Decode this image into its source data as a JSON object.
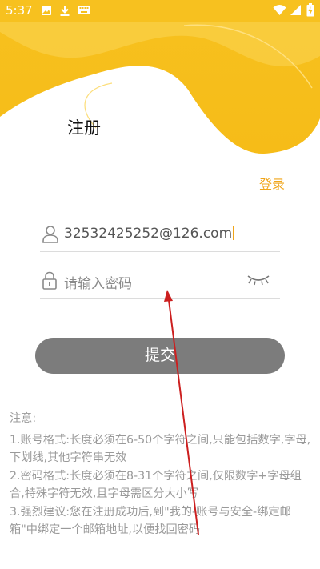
{
  "status_bar": {
    "time": "5:37",
    "left_icons": [
      "image-icon",
      "download-icon",
      "keyboard-icon"
    ],
    "right_icons": [
      "wifi-icon",
      "signal-icon",
      "battery-icon"
    ]
  },
  "header": {
    "title": "注册"
  },
  "login_link": "登录",
  "account": {
    "value": "32532425252@126.com",
    "icon": "user-icon"
  },
  "password": {
    "placeholder": "请输入密码",
    "icon": "lock-icon",
    "toggle_icon": "eye-closed-icon"
  },
  "submit_label": "提交",
  "notes": {
    "title": "注意:",
    "items": [
      "1.账号格式:长度必须在6-50个字符之间,只能包括数字,字母,下划线,其他字符串无效",
      "2.密码格式:长度必须在8-31个字符之间,仅限数字+字母组合,特殊字符无效,且字母需区分大小写",
      "3.强烈建议:您在注册成功后,到\"我的-账号与安全-绑定邮箱\"中绑定一个邮箱地址,以便找回密码"
    ]
  },
  "colors": {
    "accent_yellow": "#f7c11f",
    "login_link": "#f0a51a",
    "submit_bg": "#7c7c7c",
    "notes_text": "#9a9a9a",
    "annotation_arrow": "#cc1f1f"
  }
}
